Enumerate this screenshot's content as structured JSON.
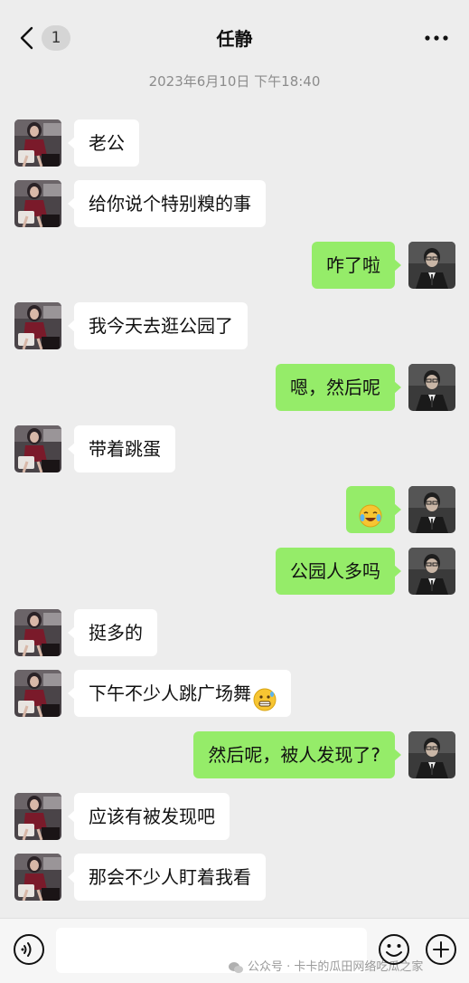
{
  "header": {
    "unread_count": "1",
    "title": "任静"
  },
  "timestamp": "2023年6月10日 下午18:40",
  "messages": [
    {
      "side": "left",
      "text": "老公"
    },
    {
      "side": "left",
      "text": "给你说个特别糗的事"
    },
    {
      "side": "right",
      "text": "咋了啦"
    },
    {
      "side": "left",
      "text": "我今天去逛公园了"
    },
    {
      "side": "right",
      "text": "嗯，然后呢"
    },
    {
      "side": "left",
      "text": "带着跳蛋"
    },
    {
      "side": "right",
      "text": "",
      "emoji": "laughing-crying-emoji"
    },
    {
      "side": "right",
      "text": "公园人多吗"
    },
    {
      "side": "left",
      "text": "挺多的"
    },
    {
      "side": "left",
      "text": "下午不少人跳广场舞",
      "emoji": "grimace-emoji"
    },
    {
      "side": "right",
      "text": "然后呢，被人发现了?"
    },
    {
      "side": "left",
      "text": "应该有被发现吧"
    },
    {
      "side": "left",
      "text": "那会不少人盯着我看"
    }
  ],
  "footer": {
    "input_value": "",
    "watermark": "公众号 · 卡卡的瓜田网络吃瓜之家"
  },
  "colors": {
    "background": "#ededed",
    "outgoing_bubble": "#95ec69",
    "incoming_bubble": "#ffffff"
  }
}
